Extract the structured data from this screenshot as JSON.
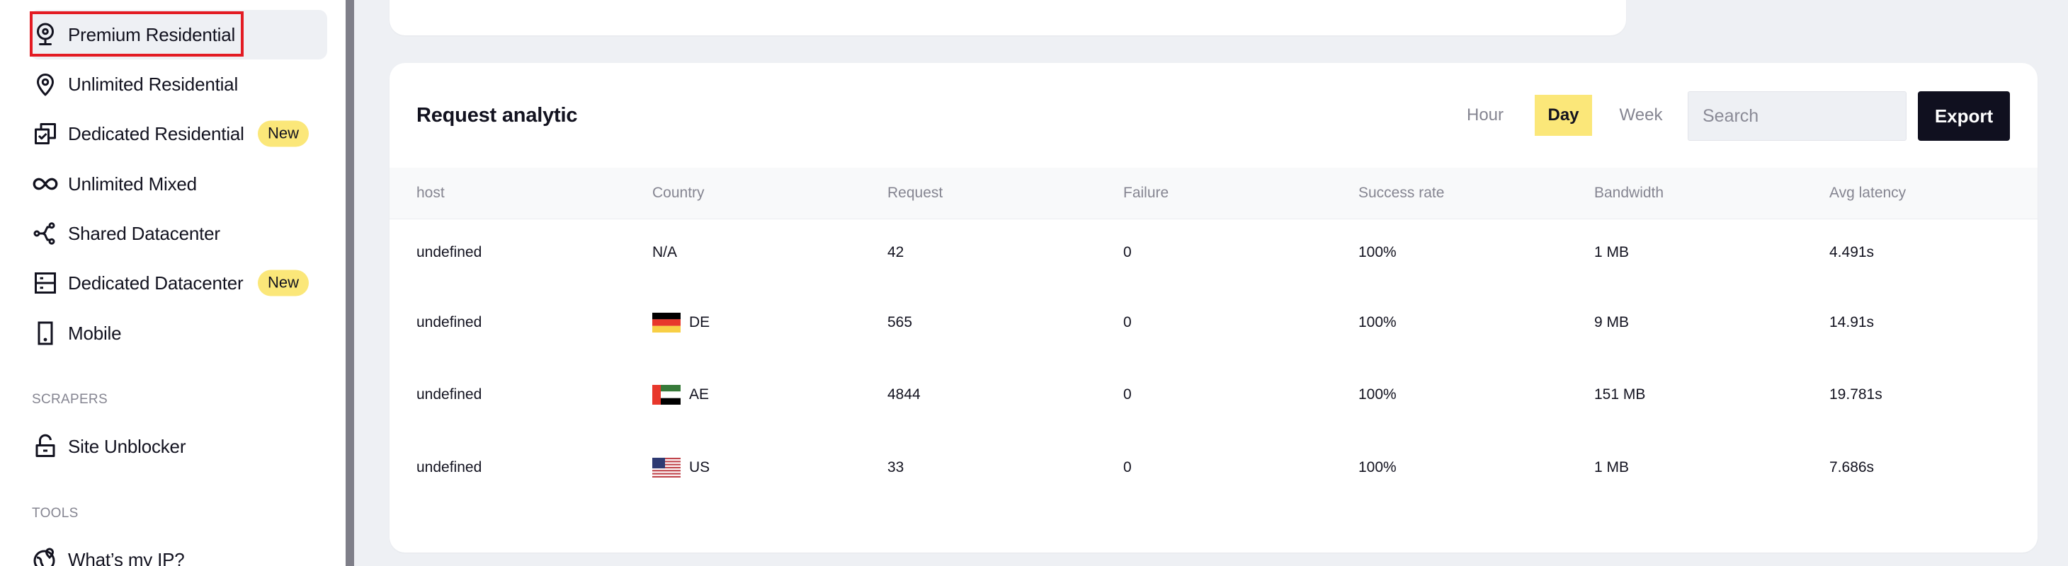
{
  "sidebar": {
    "items": [
      {
        "label": "Premium Residential",
        "icon": "webcam-pin-icon",
        "active": true,
        "badge": null
      },
      {
        "label": "Unlimited Residential",
        "icon": "map-pin-icon",
        "active": false,
        "badge": null
      },
      {
        "label": "Dedicated Residential",
        "icon": "copy-check-icon",
        "active": false,
        "badge": "New"
      },
      {
        "label": "Unlimited Mixed",
        "icon": "infinity-icon",
        "active": false,
        "badge": null
      },
      {
        "label": "Shared Datacenter",
        "icon": "share-nodes-icon",
        "active": false,
        "badge": null
      },
      {
        "label": "Dedicated Datacenter",
        "icon": "server-icon",
        "active": false,
        "badge": "New"
      },
      {
        "label": "Mobile",
        "icon": "mobile-phone-icon",
        "active": false,
        "badge": null
      }
    ],
    "sections": [
      {
        "title": "SCRAPERS",
        "items": [
          {
            "label": "Site Unblocker",
            "icon": "unlock-icon"
          }
        ]
      },
      {
        "title": "TOOLS",
        "items": [
          {
            "label": "What’s my IP?",
            "icon": "globe-pin-icon"
          }
        ]
      }
    ]
  },
  "analytics": {
    "title": "Request analytic",
    "periods": [
      {
        "label": "Hour",
        "active": false
      },
      {
        "label": "Day",
        "active": true
      },
      {
        "label": "Week",
        "active": false
      }
    ],
    "search": {
      "placeholder": "Search",
      "value": ""
    },
    "export_label": "Export",
    "columns": [
      "host",
      "Country",
      "Request",
      "Failure",
      "Success rate",
      "Bandwidth",
      "Avg latency"
    ],
    "rows": [
      {
        "host": "undefined",
        "country": "N/A",
        "flag": null,
        "request": "42",
        "failure": "0",
        "success_rate": "100%",
        "bandwidth": "1 MB",
        "avg_latency": "4.491s"
      },
      {
        "host": "undefined",
        "country": "DE",
        "flag": "flag-germany-icon",
        "request": "565",
        "failure": "0",
        "success_rate": "100%",
        "bandwidth": "9 MB",
        "avg_latency": "14.91s"
      },
      {
        "host": "undefined",
        "country": "AE",
        "flag": "flag-uae-icon",
        "request": "4844",
        "failure": "0",
        "success_rate": "100%",
        "bandwidth": "151 MB",
        "avg_latency": "19.781s"
      },
      {
        "host": "undefined",
        "country": "US",
        "flag": "flag-usa-icon",
        "request": "33",
        "failure": "0",
        "success_rate": "100%",
        "bandwidth": "1 MB",
        "avg_latency": "7.686s"
      }
    ]
  },
  "colors": {
    "accent_yellow": "#fbe779",
    "dark": "#10101f",
    "highlight_red": "#e31b23",
    "muted_text": "#858591",
    "page_bg": "#eef0f4"
  }
}
